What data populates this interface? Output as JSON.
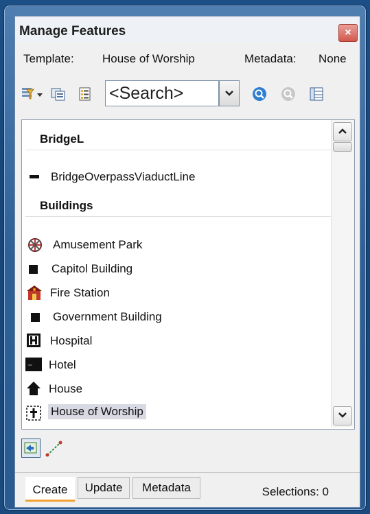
{
  "window": {
    "title": "Manage Features",
    "close_label": "×"
  },
  "template_row": {
    "template_label": "Template:",
    "template_value": "House of Worship",
    "metadata_label": "Metadata:",
    "metadata_value": "None"
  },
  "toolbar": {
    "search_placeholder": "<Search>",
    "dropdown_glyph": "⌄"
  },
  "groups": [
    {
      "header": "BridgeL",
      "items": [
        {
          "label": "BridgeOverpassViaductLine",
          "icon": "line-symbol-icon"
        }
      ]
    },
    {
      "header": "Buildings",
      "items": [
        {
          "label": "Amusement Park",
          "icon": "amusement-park-icon"
        },
        {
          "label": "Capitol Building",
          "icon": "square-symbol-icon"
        },
        {
          "label": "Fire Station",
          "icon": "fire-station-icon"
        },
        {
          "label": "Government Building",
          "icon": "square-symbol-icon"
        },
        {
          "label": "Hospital",
          "icon": "hospital-icon"
        },
        {
          "label": "Hotel",
          "icon": "hotel-icon"
        },
        {
          "label": "House",
          "icon": "house-icon"
        },
        {
          "label": "House of Worship",
          "icon": "worship-cross-icon",
          "selected": true
        }
      ]
    }
  ],
  "scrollbar": {
    "up": "▲",
    "down": "▼"
  },
  "tabs": [
    {
      "label": "Create",
      "active": true
    },
    {
      "label": "Update",
      "active": false
    },
    {
      "label": "Metadata",
      "active": false
    }
  ],
  "status": {
    "selections": "Selections: 0"
  },
  "colors": {
    "desktop_bg": "#1b4a7e",
    "close_button": "#d2574b",
    "selection_highlight": "#d9d9e4",
    "active_tab_underline": "#f0a030"
  }
}
